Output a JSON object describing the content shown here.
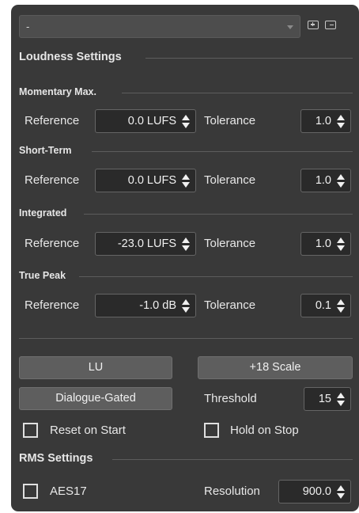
{
  "preset": {
    "value": "-"
  },
  "loudness": {
    "title": "Loudness Settings",
    "reference_label": "Reference",
    "tolerance_label": "Tolerance",
    "groups": [
      {
        "title": "Momentary Max.",
        "reference": "0.0 LUFS",
        "tolerance": "1.0"
      },
      {
        "title": "Short-Term",
        "reference": "0.0 LUFS",
        "tolerance": "1.0"
      },
      {
        "title": "Integrated",
        "reference": "-23.0 LUFS",
        "tolerance": "1.0"
      },
      {
        "title": "True Peak",
        "reference": "-1.0 dB",
        "tolerance": "0.1"
      }
    ]
  },
  "buttons": {
    "lu": "LU",
    "scale": "+18 Scale",
    "dialogue": "Dialogue-Gated"
  },
  "threshold": {
    "label": "Threshold",
    "value": "15"
  },
  "checks": {
    "reset": "Reset on Start",
    "hold": "Hold on Stop"
  },
  "rms": {
    "title": "RMS Settings",
    "aes17": "AES17",
    "resolution_label": "Resolution",
    "resolution": "900.0"
  }
}
